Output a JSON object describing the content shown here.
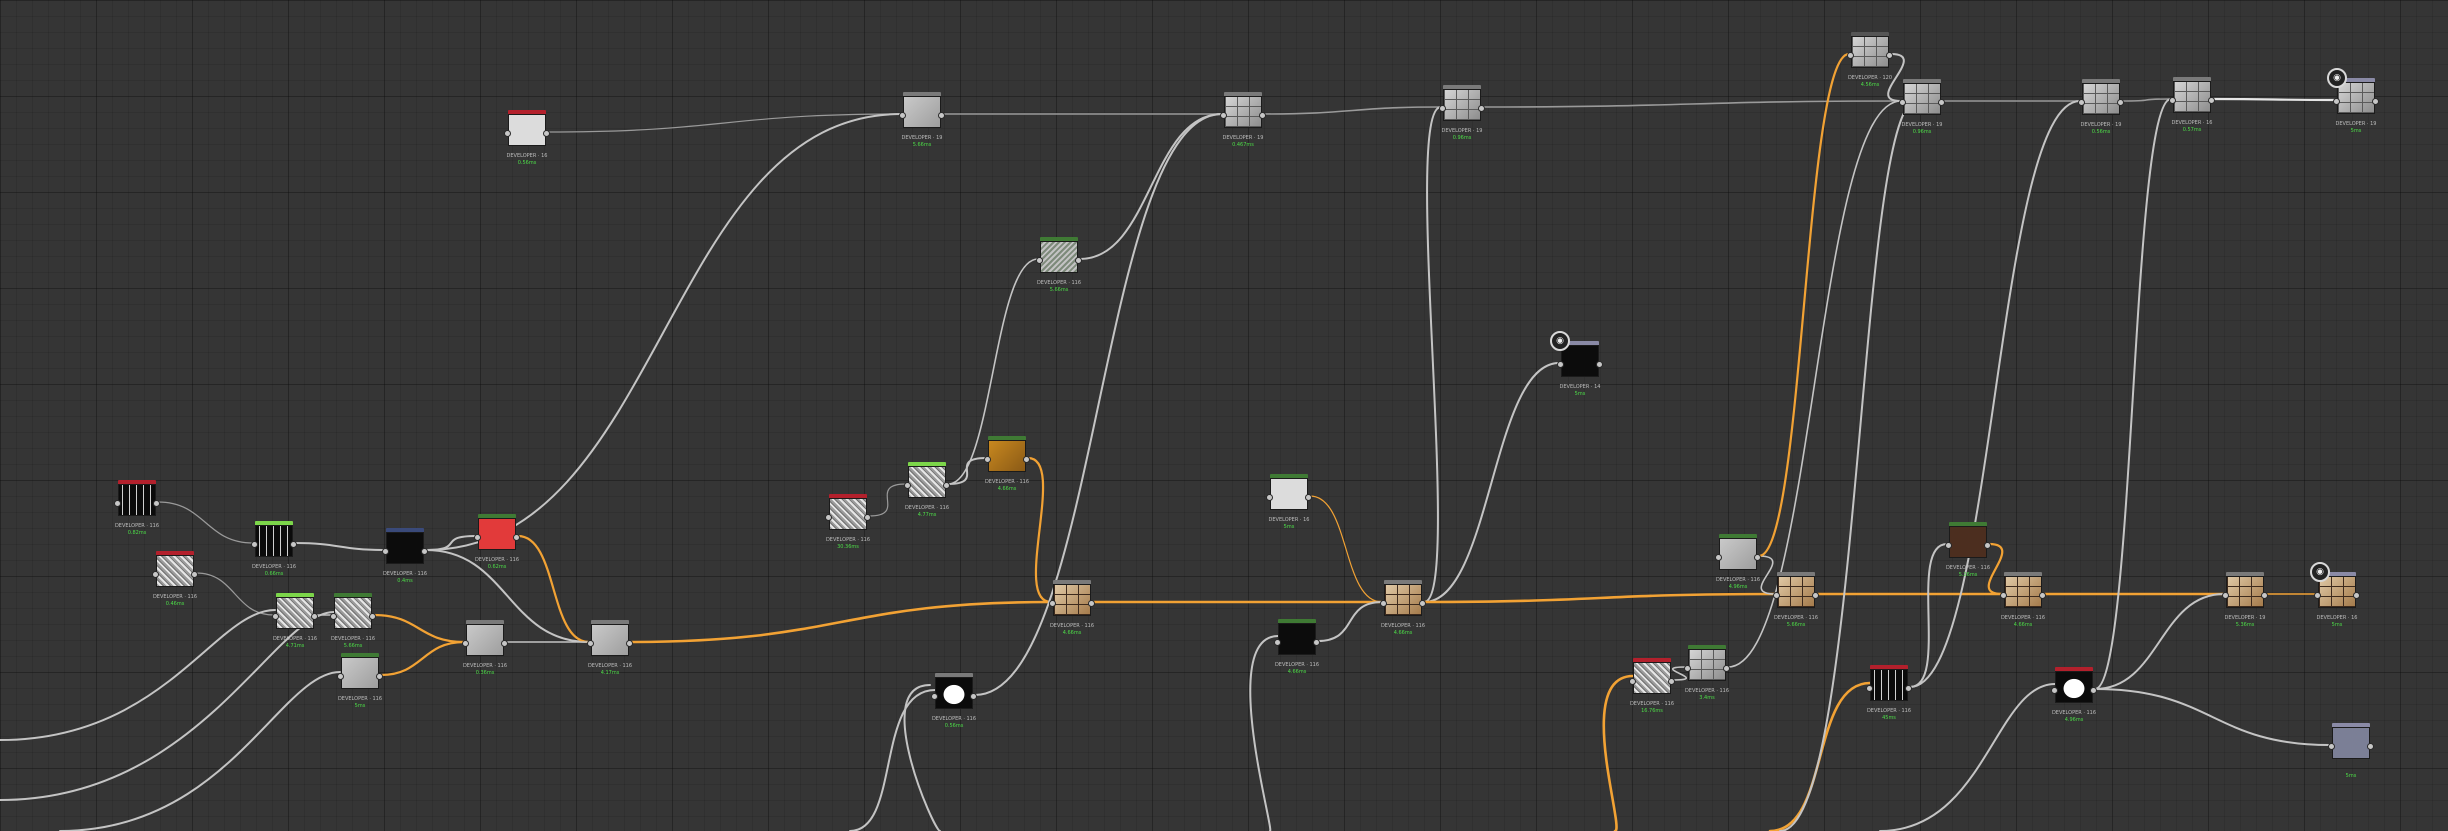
{
  "canvas": {
    "grid": true,
    "background": "#353535"
  },
  "colors": {
    "wire_gray": "#9a9a9a",
    "wire_light": "#c4c4c4",
    "wire_orange": "#f2a234",
    "output_green": "#4ddc48",
    "header_red": "#b3202c",
    "header_green": "#3f7a34",
    "header_lime": "#7cd64a",
    "header_navy": "#3a4a7a",
    "header_gray": "#7a7a7a",
    "header_purple": "#8a8aa6"
  },
  "nodes": [
    {
      "id": "n1",
      "name": "node-source-red-1",
      "thumb": "t-white",
      "header": "#b3202c",
      "caption": "DEVELOPER · 16",
      "time": "0.56ms"
    },
    {
      "id": "n2",
      "name": "node-blend-top-1",
      "thumb": "t-light",
      "header": "#7a7a7a",
      "caption": "DEVELOPER · 19",
      "time": "5.66ms"
    },
    {
      "id": "n3",
      "name": "node-stone-top-1",
      "thumb": "t-stone",
      "header": "#7a7a7a",
      "caption": "DEVELOPER · 19",
      "time": "0.467ms"
    },
    {
      "id": "n4",
      "name": "node-stone-top-2",
      "thumb": "t-stone",
      "header": "#7a7a7a",
      "caption": "DEVELOPER · 19",
      "time": "0.96ms"
    },
    {
      "id": "n5",
      "name": "node-stone-top-3",
      "thumb": "t-stone",
      "header": "#555555",
      "caption": "DEVELOPER · 120",
      "time": "4.56ms"
    },
    {
      "id": "n6",
      "name": "node-stone-top-4",
      "thumb": "t-stone",
      "header": "#7a7a7a",
      "caption": "DEVELOPER · 19",
      "time": "0.96ms"
    },
    {
      "id": "n7",
      "name": "node-stone-top-5",
      "thumb": "t-stone",
      "header": "#7a7a7a",
      "caption": "DEVELOPER · 19",
      "time": "0.56ms"
    },
    {
      "id": "n8",
      "name": "node-stone-top-6",
      "thumb": "t-stone",
      "header": "#7a7a7a",
      "caption": "DEVELOPER · 16",
      "time": "0.57ms"
    },
    {
      "id": "n9",
      "name": "node-output-top",
      "thumb": "t-stone",
      "header": "#8a8aa6",
      "caption": "DEVELOPER · 19",
      "time": "5ms"
    },
    {
      "id": "n10",
      "name": "node-noise-green",
      "thumb": "t-green",
      "header": "#3f7a34",
      "caption": "DEVELOPER · 116",
      "time": "5.66ms"
    },
    {
      "id": "n11",
      "name": "node-output-dark",
      "thumb": "t-dark",
      "header": "#8a8aa6",
      "caption": "DEVELOPER · 14",
      "time": "5ms"
    },
    {
      "id": "n12",
      "name": "node-pattern-black",
      "thumb": "t-dark-pattern",
      "header": "#b3202c",
      "caption": "DEVELOPER · 116",
      "time": "0.82ms"
    },
    {
      "id": "n13",
      "name": "node-noise-red",
      "thumb": "t-noise",
      "header": "#b3202c",
      "caption": "DEVELOPER · 116",
      "time": "0.46ms"
    },
    {
      "id": "n14",
      "name": "node-pattern-lime",
      "thumb": "t-dark-pattern",
      "header": "#7cd64a",
      "caption": "DEVELOPER · 116",
      "time": "0.66ms"
    },
    {
      "id": "n15",
      "name": "node-dark-navy",
      "thumb": "t-dark",
      "header": "#3a4a7a",
      "caption": "DEVELOPER · 116",
      "time": "0.4ms"
    },
    {
      "id": "n16",
      "name": "node-red-color",
      "thumb": "t-red",
      "header": "#3f7a34",
      "caption": "DEVELOPER · 116",
      "time": "0.62ms"
    },
    {
      "id": "n17",
      "name": "node-noise-lime",
      "thumb": "t-noise",
      "header": "#7cd64a",
      "caption": "DEVELOPER · 116",
      "time": "4.71ms"
    },
    {
      "id": "n18",
      "name": "node-noise-olive",
      "thumb": "t-noise",
      "header": "#3f7a34",
      "caption": "DEVELOPER · 116",
      "time": "5.66ms"
    },
    {
      "id": "n19",
      "name": "node-blend-mid-1",
      "thumb": "t-light",
      "header": "#7a7a7a",
      "caption": "DEVELOPER · 116",
      "time": "0.36ms"
    },
    {
      "id": "n20",
      "name": "node-light-olive",
      "thumb": "t-light",
      "header": "#3f7a34",
      "caption": "DEVELOPER · 116",
      "time": "5ms"
    },
    {
      "id": "n21",
      "name": "node-blend-mid-2",
      "thumb": "t-light",
      "header": "#7a7a7a",
      "caption": "DEVELOPER · 116",
      "time": "4.17ms"
    },
    {
      "id": "n22",
      "name": "node-noise-red-2",
      "thumb": "t-noise",
      "header": "#b3202c",
      "caption": "DEVELOPER · 116",
      "time": "30.36ms"
    },
    {
      "id": "n23",
      "name": "node-noise-lime-2",
      "thumb": "t-noise",
      "header": "#7cd64a",
      "caption": "DEVELOPER · 116",
      "time": "4.77ms"
    },
    {
      "id": "n24",
      "name": "node-orange",
      "thumb": "t-orange",
      "header": "#3f7a34",
      "caption": "DEVELOPER · 116",
      "time": "4.66ms"
    },
    {
      "id": "n25",
      "name": "node-brick-1",
      "thumb": "t-brick",
      "header": "#7a7a7a",
      "caption": "DEVELOPER · 116",
      "time": "4.66ms"
    },
    {
      "id": "n26",
      "name": "node-blackwhite",
      "thumb": "t-blackwhite",
      "header": "#7a7a7a",
      "caption": "DEVELOPER · 116",
      "time": "0.56ms"
    },
    {
      "id": "n27",
      "name": "node-light-green-1",
      "thumb": "t-white",
      "header": "#3f7a34",
      "caption": "DEVELOPER · 16",
      "time": "5ms"
    },
    {
      "id": "n28",
      "name": "node-dark-green",
      "thumb": "t-dark",
      "header": "#3f7a34",
      "caption": "DEVELOPER · 116",
      "time": "4.66ms"
    },
    {
      "id": "n29",
      "name": "node-brick-2",
      "thumb": "t-brick",
      "header": "#7a7a7a",
      "caption": "DEVELOPER · 116",
      "time": "4.66ms"
    },
    {
      "id": "n30",
      "name": "node-light-green-2",
      "thumb": "t-light",
      "header": "#3f7a34",
      "caption": "DEVELOPER · 116",
      "time": "4.96ms"
    },
    {
      "id": "n31",
      "name": "node-brick-3",
      "thumb": "t-brick",
      "header": "#7a7a7a",
      "caption": "DEVELOPER · 116",
      "time": "5.66ms"
    },
    {
      "id": "n32",
      "name": "node-noise-red-3",
      "thumb": "t-noise",
      "header": "#b3202c",
      "caption": "DEVELOPER · 116",
      "time": "16.76ms"
    },
    {
      "id": "n33",
      "name": "node-stone-green",
      "thumb": "t-stone",
      "header": "#3f7a34",
      "caption": "DEVELOPER · 116",
      "time": "3.4ms"
    },
    {
      "id": "n34",
      "name": "node-dark-pattern-red",
      "thumb": "t-dark-pattern",
      "header": "#b3202c",
      "caption": "DEVELOPER · 116",
      "time": "45ms"
    },
    {
      "id": "n35",
      "name": "node-brown",
      "thumb": "t-brown",
      "header": "#3f7a34",
      "caption": "DEVELOPER · 116",
      "time": "5.26ms"
    },
    {
      "id": "n36",
      "name": "node-brick-4",
      "thumb": "t-brick",
      "header": "#7a7a7a",
      "caption": "DEVELOPER · 116",
      "time": "4.66ms"
    },
    {
      "id": "n37",
      "name": "node-mask-red",
      "thumb": "t-blackwhite",
      "header": "#b3202c",
      "caption": "DEVELOPER · 116",
      "time": "4.96ms"
    },
    {
      "id": "n38",
      "name": "node-brick-5",
      "thumb": "t-brick",
      "header": "#7a7a7a",
      "caption": "DEVELOPER · 19",
      "time": "5.36ms"
    },
    {
      "id": "n39",
      "name": "node-output-brick",
      "thumb": "t-brick",
      "header": "#8a8aa6",
      "caption": "DEVELOPER · 16",
      "time": "5ms"
    },
    {
      "id": "n40",
      "name": "node-output-purple",
      "thumb": "t-purple",
      "header": "#8a8aa6",
      "caption": "",
      "time": "5ms"
    }
  ]
}
